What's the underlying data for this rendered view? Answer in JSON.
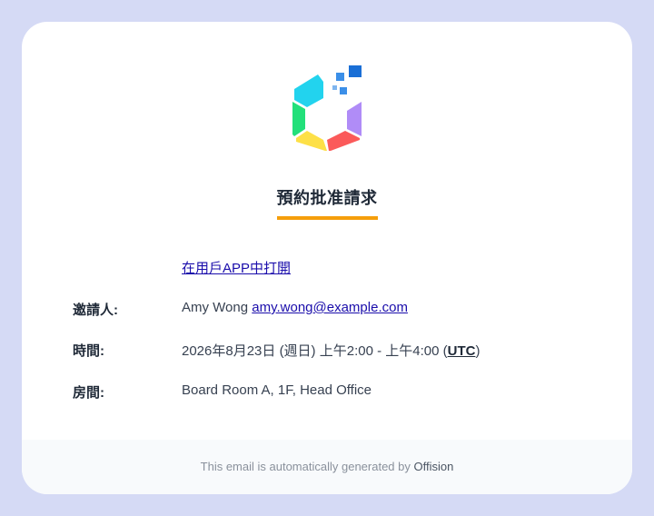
{
  "email": {
    "title": "預約批准請求",
    "open_in_app_label": "在用戶APP中打開",
    "inviter": {
      "label": "邀請人:",
      "name": "Amy Wong",
      "email": "amy.wong@example.com"
    },
    "time": {
      "label": "時間:",
      "value_prefix": "2026年8月23日 (週日) 上午2:00 - 上午4:00 (",
      "timezone": "UTC",
      "value_suffix": ")"
    },
    "room": {
      "label": "房間:",
      "value": "Board Room A, 1F, Head Office"
    },
    "footer": {
      "text": "This email is automatically generated by ",
      "brand": "Offision"
    }
  },
  "logo": {
    "icon": "hexagon-cube-logo-icon",
    "colors": {
      "cyan": "#22d3ee",
      "green": "#22e07a",
      "yellow": "#fde047",
      "red": "#fb5a5a",
      "purple": "#b08cf7",
      "blue_dark": "#1a6fd6",
      "blue_mid": "#3b8fe8",
      "blue_light": "#7fb5ef"
    }
  },
  "accent_color": "#f59e0b",
  "background_color": "#d5daf5"
}
